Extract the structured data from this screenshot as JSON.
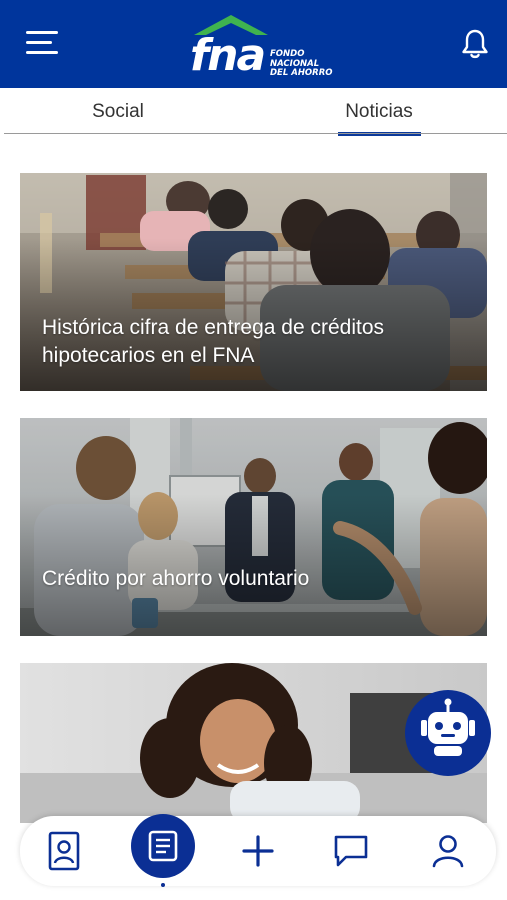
{
  "header": {
    "logo_text": "fna",
    "logo_subtitle": [
      "FONDO",
      "NACIONAL",
      "DEL AHORRO"
    ],
    "brand_color": "#00359c",
    "roof_color": "#3fb34f",
    "menu_icon": "hamburger-menu-icon",
    "bell_icon": "bell-icon"
  },
  "tabs": [
    {
      "label": "Social",
      "active": false
    },
    {
      "label": "Noticias",
      "active": true
    }
  ],
  "cards": [
    {
      "title": "Histórica cifra de entrega de créditos hipotecarios en el FNA"
    },
    {
      "title": "Crédito por ahorro voluntario"
    },
    {
      "title": ""
    }
  ],
  "assistant": {
    "icon": "chatbot-icon"
  },
  "bottom_nav": {
    "items": [
      {
        "icon": "contact-card-icon",
        "active": false
      },
      {
        "icon": "news-list-icon",
        "active": true
      },
      {
        "icon": "plus-icon",
        "active": false
      },
      {
        "icon": "chat-icon",
        "active": false
      },
      {
        "icon": "profile-icon",
        "active": false
      }
    ],
    "active_color": "#0b2f94"
  }
}
